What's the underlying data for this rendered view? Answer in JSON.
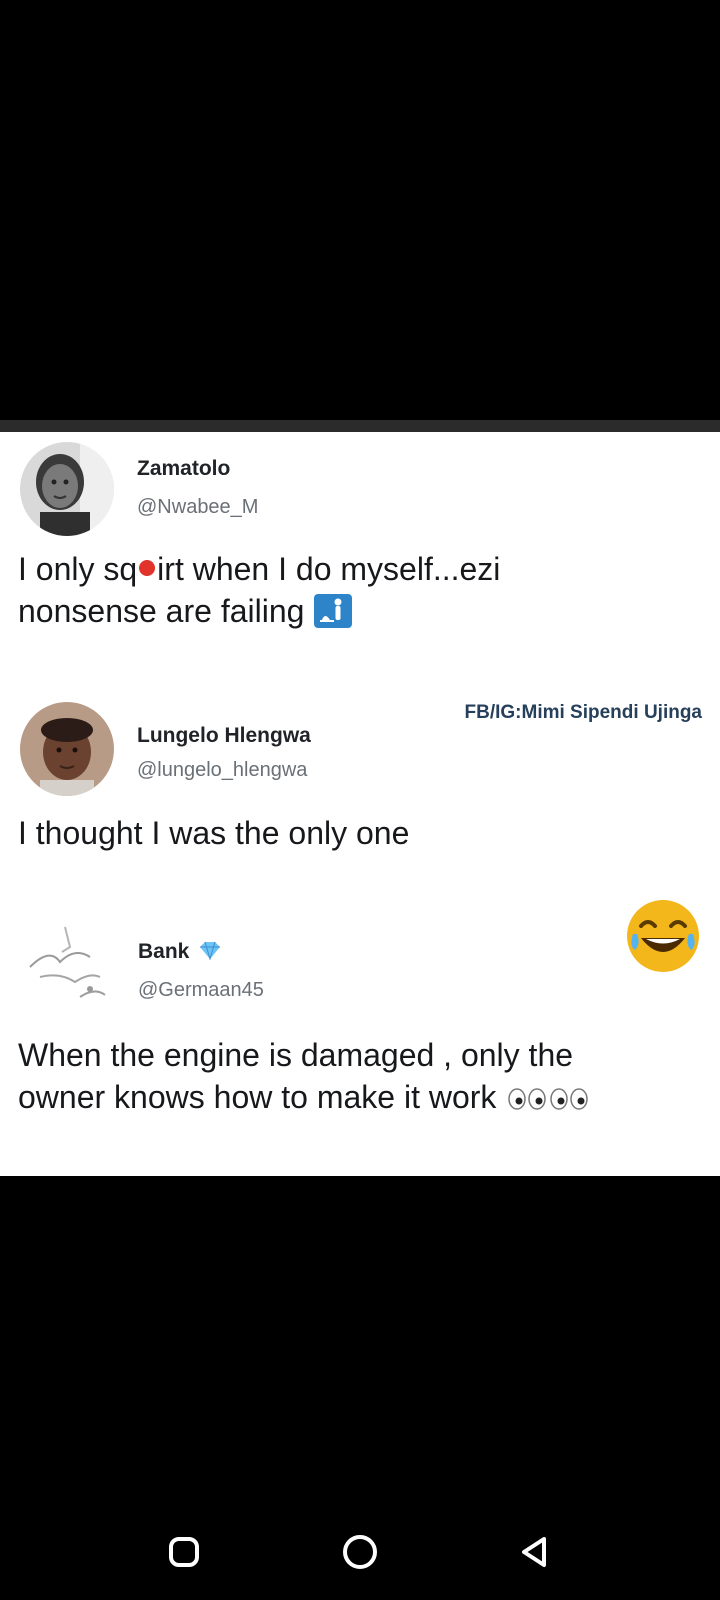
{
  "posts": [
    {
      "name": "Zamatolo",
      "handle": "@Nwabee_M",
      "text_part1": "I only sq",
      "text_part2": "irt when I do myself...ezi",
      "text_line2": "nonsense are failing",
      "trailing_icon": "restroom-icon"
    },
    {
      "name": "Lungelo Hlengwa",
      "handle": "@lungelo_hlengwa",
      "text": "I thought I was the only one"
    },
    {
      "name": "Bank",
      "badge_icon": "diamond-icon",
      "handle": "@Germaan45",
      "text_line1": "When the engine is damaged , only the",
      "text_line2": "owner knows how to make it work",
      "trailing_icon": "eyes-icon"
    }
  ],
  "watermark": "FB/IG:Mimi Sipendi Ujinga",
  "floating_emoji": "laughing-tears-icon",
  "nav": {
    "recents": "recents-icon",
    "home": "home-icon",
    "back": "back-icon"
  },
  "colors": {
    "background": "#000000",
    "card": "#ffffff",
    "name": "#202327",
    "handle": "#6a7077",
    "watermark": "#263f5a"
  }
}
